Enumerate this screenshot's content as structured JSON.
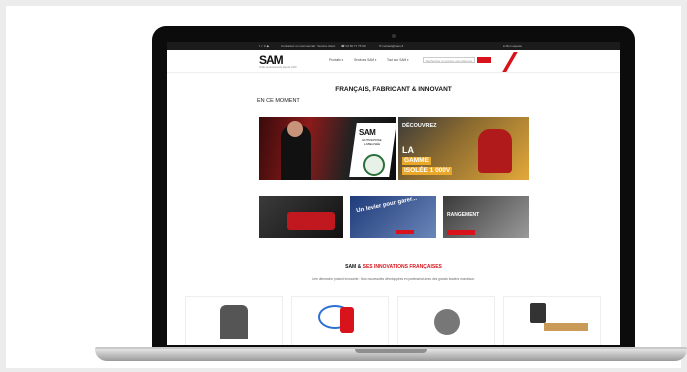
{
  "topbar": {
    "social": "f  ✓  in  ▶",
    "item1": "Contactez un commercial : Service client",
    "item2": "☎ 04 50 77 75 00",
    "item3": "✉ contact@sam.fr",
    "account": "● Mon espace"
  },
  "header": {
    "logo": "SAM",
    "logo_sub": "Outils professionnels depuis 1920",
    "nav": [
      "Produits ▾",
      "Services SAM ▾",
      "Tout sur SAM ▾"
    ],
    "search_placeholder": "Rechercher un produit, une référence"
  },
  "main": {
    "heading": "FRANÇAIS, FABRICANT & INNOVANT",
    "subheading": "EN CE MOMENT",
    "banner_left": {
      "card_title": "SAM",
      "card_text": "ENTREPRISE LABELISÉE"
    },
    "banner_right": {
      "line1": "DÉCOUVREZ",
      "line2": "LA",
      "line3": "GAMME",
      "line4": "ISOLÉE 1 000V"
    },
    "tiles": [
      {
        "label": ""
      },
      {
        "label": "Un levier pour garer..."
      },
      {
        "label": "RANGEMENT"
      }
    ],
    "section_title_prefix": "SAM & ",
    "section_title_red": "SES INNOVATIONS FRANÇAISES",
    "section_text": "Une démarche produit innovante : Nos nouveautés développées en partenariat avec des grands leaders mondiaux."
  },
  "colors": {
    "brand_red": "#d8131b",
    "topbar_bg": "#1b1b1b"
  }
}
